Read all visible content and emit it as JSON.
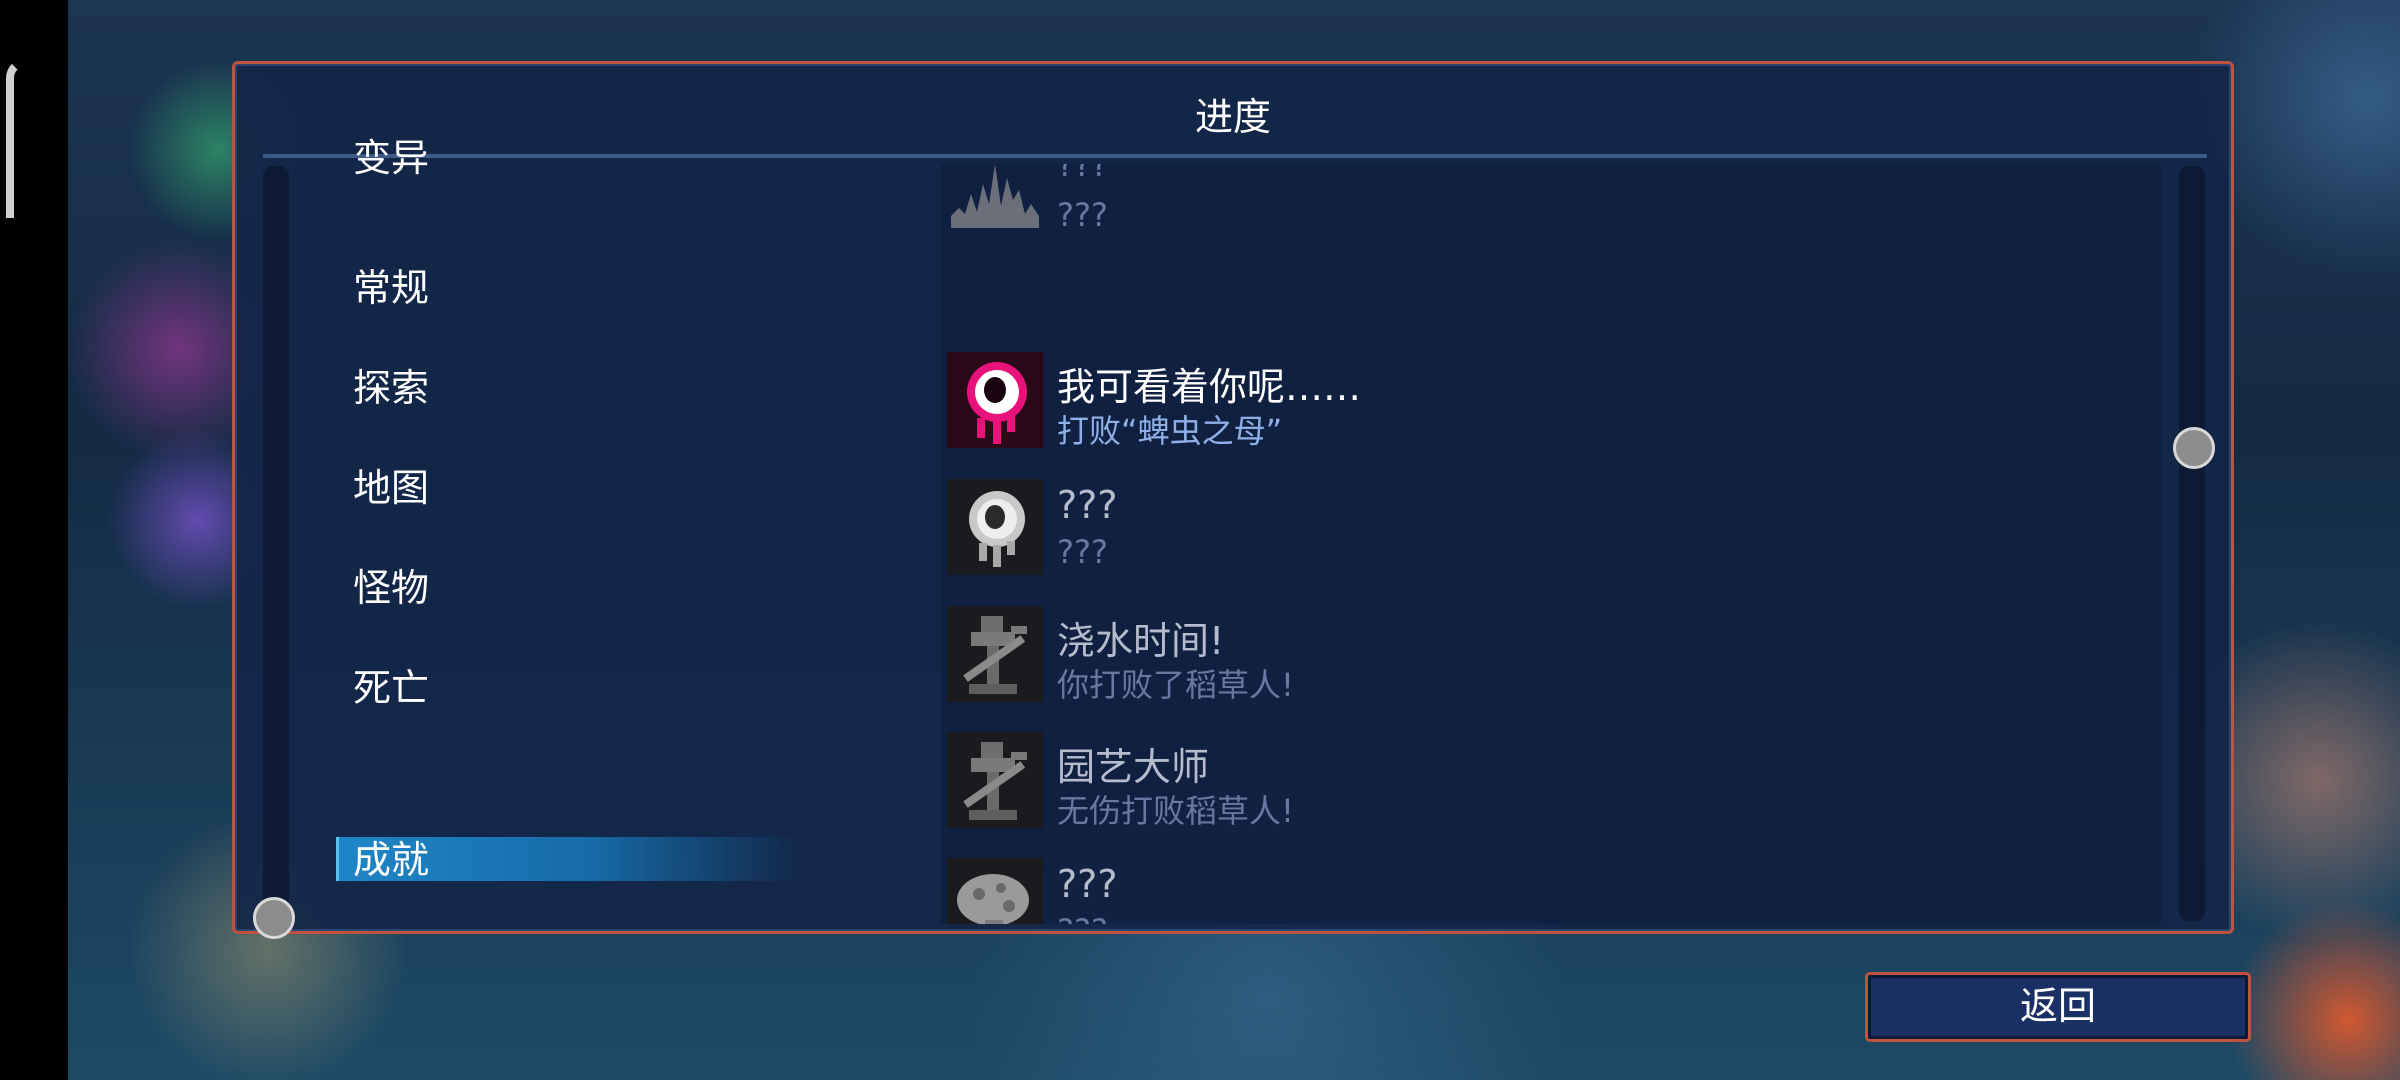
{
  "panel": {
    "title": "进度"
  },
  "categories": [
    {
      "label": "变异"
    },
    {
      "label": "常规"
    },
    {
      "label": "探索"
    },
    {
      "label": "地图"
    },
    {
      "label": "怪物"
    },
    {
      "label": "死亡"
    },
    {
      "label": "成就",
      "selected": true
    }
  ],
  "achievements": [
    {
      "title": "???",
      "description": "???",
      "unlocked": false,
      "icon": "waveform-icon"
    },
    {
      "title": "我可看着你呢……",
      "description": "打败“蜱虫之母”",
      "unlocked": true,
      "icon": "eyeball-icon"
    },
    {
      "title": "???",
      "description": "???",
      "unlocked": false,
      "icon": "eyeball-icon"
    },
    {
      "title": "浇水时间!",
      "description": "你打败了稻草人!",
      "unlocked": false,
      "icon": "watering-can-icon"
    },
    {
      "title": "园艺大师",
      "description": "无伤打败稻草人!",
      "unlocked": false,
      "icon": "watering-can-icon"
    },
    {
      "title": "???",
      "description": "???",
      "unlocked": false,
      "icon": "mushroom-icon"
    }
  ],
  "footer": {
    "back_label": "返回"
  },
  "colors": {
    "accent_border": "#c0533e",
    "selected_tab": "#1e86c8",
    "unlocked_title": "#ffffff",
    "unlocked_desc": "#8fb0e6",
    "locked_title": "#b5bccb",
    "locked_desc": "#6878a0"
  }
}
